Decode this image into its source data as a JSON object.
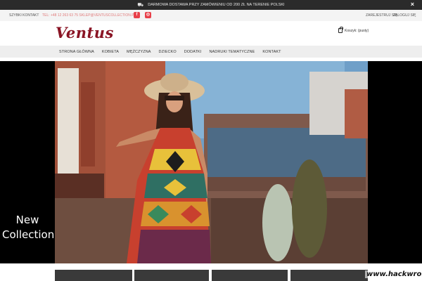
{
  "topbar": {
    "shipping_text": "DARMOWA DOSTAWA PRZY ZAMÓWIENIU OD 200 ZŁ NA TERENIE POLSKI",
    "truck_icon": "truck-icon",
    "close_label": "×"
  },
  "infobar": {
    "quick_contact": "SZYBKI KONTAKT",
    "contact_line": "TEL: +48 12 263 63 75   SKLEP@VENTUSCOLLECTION.PL",
    "facebook_glyph": "f",
    "instagram_glyph": "◎",
    "register": "ZAREJESTRUJ SIĘ",
    "login": "ZALOGUJ SIĘ"
  },
  "header": {
    "logo": "Ventus",
    "cart_label": "Koszyk: (pusty)"
  },
  "nav": {
    "items": [
      {
        "label": "STRONA GŁÓWNA"
      },
      {
        "label": "KOBIETA"
      },
      {
        "label": "MĘŻCZYZNA"
      },
      {
        "label": "DZIECKO"
      },
      {
        "label": "DODATKI"
      },
      {
        "label": "NADRUKI TEMATYCZNE"
      },
      {
        "label": "KONTAKT"
      }
    ]
  },
  "hero": {
    "banner_line1": "New",
    "banner_line2": "Collection"
  },
  "watermark": "www.hackwro.pl",
  "colors": {
    "brand": "#8a1424",
    "accent": "#e8404a",
    "topbar": "#2b2b2b"
  }
}
